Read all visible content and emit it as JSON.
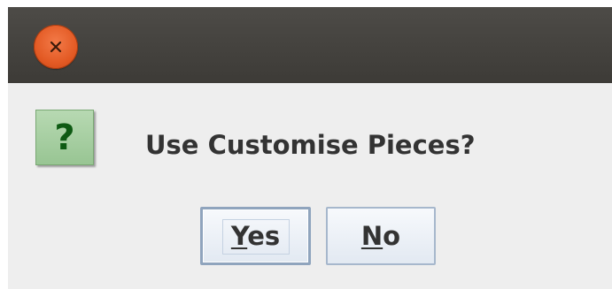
{
  "titlebar": {
    "close_icon": "close-icon"
  },
  "dialog": {
    "icon": "question-icon",
    "icon_glyph": "?",
    "message": "Use Customise Pieces?"
  },
  "buttons": {
    "yes": {
      "mnemonic": "Y",
      "rest": "es"
    },
    "no": {
      "mnemonic": "N",
      "rest": "o"
    }
  },
  "colors": {
    "titlebar": "#45433f",
    "close_button": "#e35a24",
    "content_background": "#eeeeee",
    "icon_background": "#a8cfa3",
    "icon_glyph": "#0e5a13",
    "button_border": "#a6b7cc"
  }
}
